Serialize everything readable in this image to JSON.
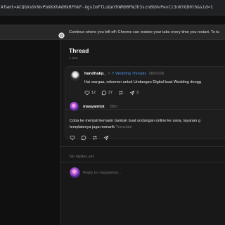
{
  "browser": {
    "url": "Afwmt=ACQGXx9rWvPbXKXhAdHkRFhkF-XgsImFTLoQeYhWR00FWJh3szn6b9vPevCi3nKYGD0th&sid=1"
  },
  "restore_bar": {
    "message": "Continue where you left off: Chrome can restore your tabs every time you restart. To tu"
  },
  "thread": {
    "title": "Thread",
    "subtitle": "1 view",
    "post": {
      "username": "handhakp_",
      "separator": ">",
      "topic": "Wedding Threads",
      "date": "08/03/26",
      "text": "Hai wargaa, rekomen untuk Undangan Digital buat Wedding dongg",
      "likes": "12",
      "replies": "37",
      "reposts": "3"
    },
    "reply": {
      "username": "masyamtot",
      "time": "28m",
      "text_line1": "Coba ke merrjali kemarin bantuin buat undangan online ke sana, layanan g",
      "text_line2": "templatenya juga menarik",
      "translate": "Translate"
    },
    "no_replies": "No replies yet",
    "reply_placeholder": "Reply to masyamtot..."
  },
  "colors": {
    "background": "#101010",
    "panel": "#181818",
    "card": "#1e1e1e",
    "accent_blue": "#4a90e2",
    "muted": "#777777"
  },
  "icons": [
    "chrome-icon",
    "heart-icon",
    "comment-icon",
    "repost-icon",
    "share-icon"
  ]
}
